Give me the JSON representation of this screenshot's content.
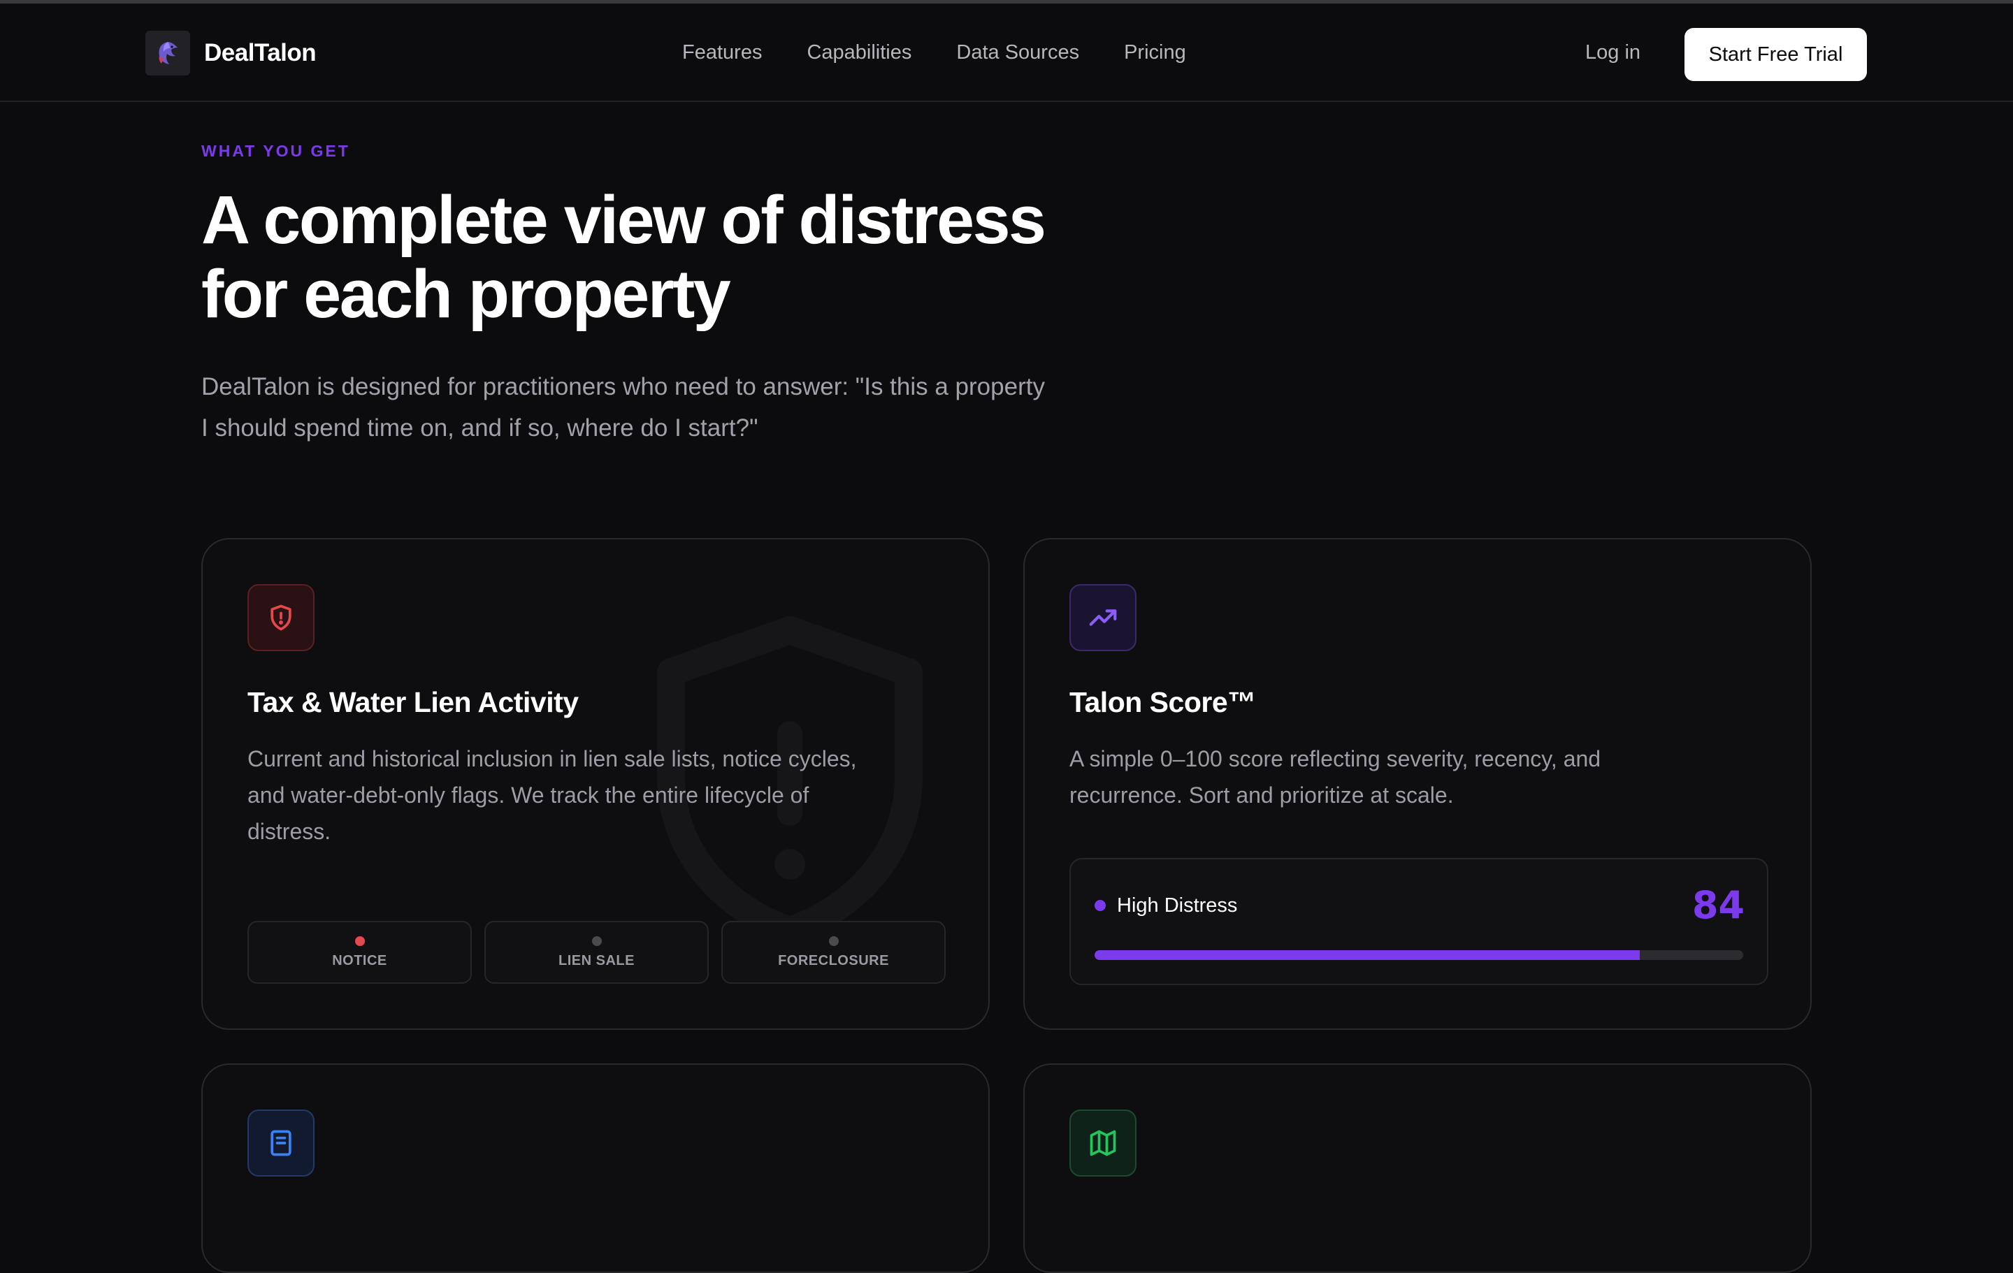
{
  "header": {
    "brand_name": "DealTalon",
    "nav": [
      {
        "label": "Features"
      },
      {
        "label": "Capabilities"
      },
      {
        "label": "Data Sources"
      },
      {
        "label": "Pricing"
      }
    ],
    "login_label": "Log in",
    "cta_label": "Start Free Trial"
  },
  "hero": {
    "eyebrow": "WHAT YOU GET",
    "headline_line1": "A complete view of distress",
    "headline_line2": "for each property",
    "lead_line1": "DealTalon is designed for practitioners who need to answer: \"Is this a property",
    "lead_line2": "I should spend time on, and if so, where do I start?\""
  },
  "cards": {
    "lien": {
      "icon": "shield-alert-icon",
      "title": "Tax & Water Lien Activity",
      "desc_line1": "Current and historical inclusion in lien sale lists, notice cycles,",
      "desc_line2": "and water-debt-only flags. We track the entire lifecycle of",
      "desc_line3": "distress.",
      "stages": [
        {
          "label": "NOTICE",
          "active": true
        },
        {
          "label": "LIEN SALE",
          "active": false
        },
        {
          "label": "FORECLOSURE",
          "active": false
        }
      ]
    },
    "score": {
      "icon": "trending-up-icon",
      "title": "Talon Score™",
      "desc_line1": "A simple 0–100 score reflecting severity, recency, and",
      "desc_line2": "recurrence. Sort and prioritize at scale.",
      "score_label": "High Distress",
      "score_value": "84",
      "score_percent": 84
    },
    "third": {
      "icon": "document-icon"
    },
    "fourth": {
      "icon": "map-icon"
    }
  },
  "colors": {
    "accent": "#7c3aed",
    "danger": "#e5484d",
    "background": "#0c0c0e"
  }
}
